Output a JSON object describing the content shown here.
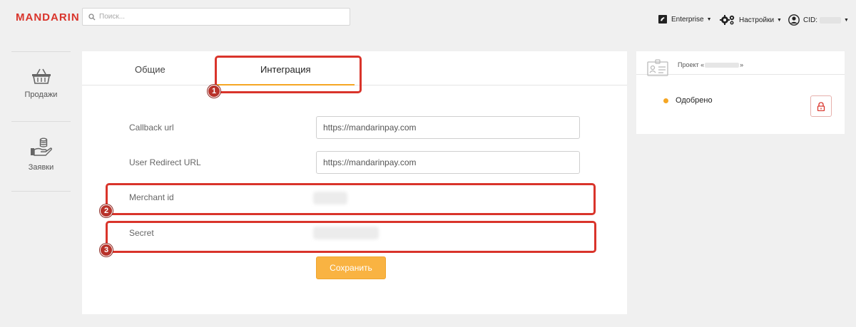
{
  "header": {
    "logo": "MANDARIN",
    "search_placeholder": "Поиск...",
    "enterprise_label": "Enterprise",
    "settings_label": "Настройки",
    "cid_label": "CID:"
  },
  "sidebar": {
    "items": [
      {
        "label": "Продажи",
        "icon": "basket-icon"
      },
      {
        "label": "Заявки",
        "icon": "coins-hand-icon"
      }
    ]
  },
  "tabs": [
    {
      "label": "Общие",
      "active": false
    },
    {
      "label": "Интеграция",
      "active": true
    }
  ],
  "form": {
    "callback_label": "Callback url",
    "callback_value": "https://mandarinpay.com",
    "redirect_label": "User Redirect URL",
    "redirect_value": "https://mandarinpay.com",
    "merchant_label": "Merchant id",
    "secret_label": "Secret",
    "save_label": "Сохранить"
  },
  "annotations": [
    "1",
    "2",
    "3"
  ],
  "project": {
    "prefix": "Проект «",
    "suffix": "»",
    "status": "Одобрено"
  },
  "colors": {
    "brand": "#d9342b",
    "accent": "#f5a623",
    "button": "#f9b342"
  }
}
